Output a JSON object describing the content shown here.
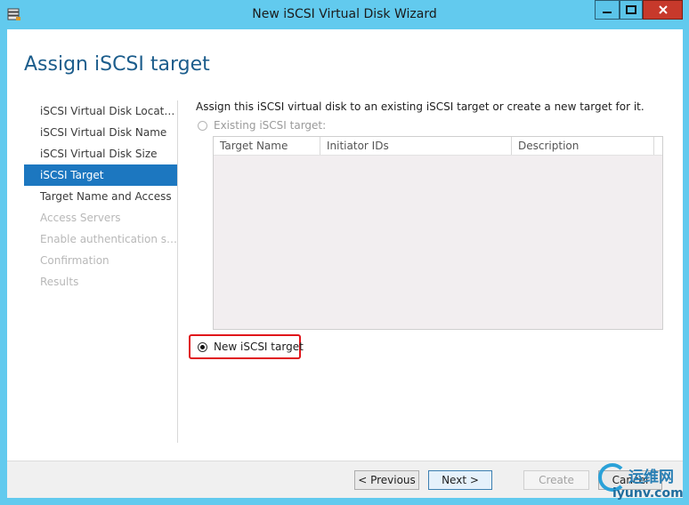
{
  "window": {
    "title": "New iSCSI Virtual Disk Wizard"
  },
  "page": {
    "heading": "Assign iSCSI target"
  },
  "nav": {
    "items": [
      {
        "label": "iSCSI Virtual Disk Location",
        "state": "normal"
      },
      {
        "label": "iSCSI Virtual Disk Name",
        "state": "normal"
      },
      {
        "label": "iSCSI Virtual Disk Size",
        "state": "normal"
      },
      {
        "label": "iSCSI Target",
        "state": "active"
      },
      {
        "label": "Target Name and Access",
        "state": "normal"
      },
      {
        "label": "Access Servers",
        "state": "disabled"
      },
      {
        "label": "Enable authentication ser...",
        "state": "disabled"
      },
      {
        "label": "Confirmation",
        "state": "disabled"
      },
      {
        "label": "Results",
        "state": "disabled"
      }
    ]
  },
  "content": {
    "intro": "Assign this iSCSI virtual disk to an existing iSCSI target or create a new target for it.",
    "existing_option": {
      "label": "Existing iSCSI target:",
      "selected": false,
      "enabled": false
    },
    "table": {
      "columns": [
        "Target Name",
        "Initiator IDs",
        "Description"
      ],
      "rows": []
    },
    "new_option": {
      "label": "New iSCSI target",
      "selected": true
    }
  },
  "footer": {
    "previous": "< Previous",
    "next": "Next >",
    "create": "Create",
    "cancel": "Cancel"
  },
  "watermark": {
    "cn": "运维网",
    "url": "iyunv.com"
  },
  "colors": {
    "accent": "#1c77c0",
    "heading": "#1c5d8c",
    "frame": "#62caee",
    "highlight": "#e0141a"
  }
}
